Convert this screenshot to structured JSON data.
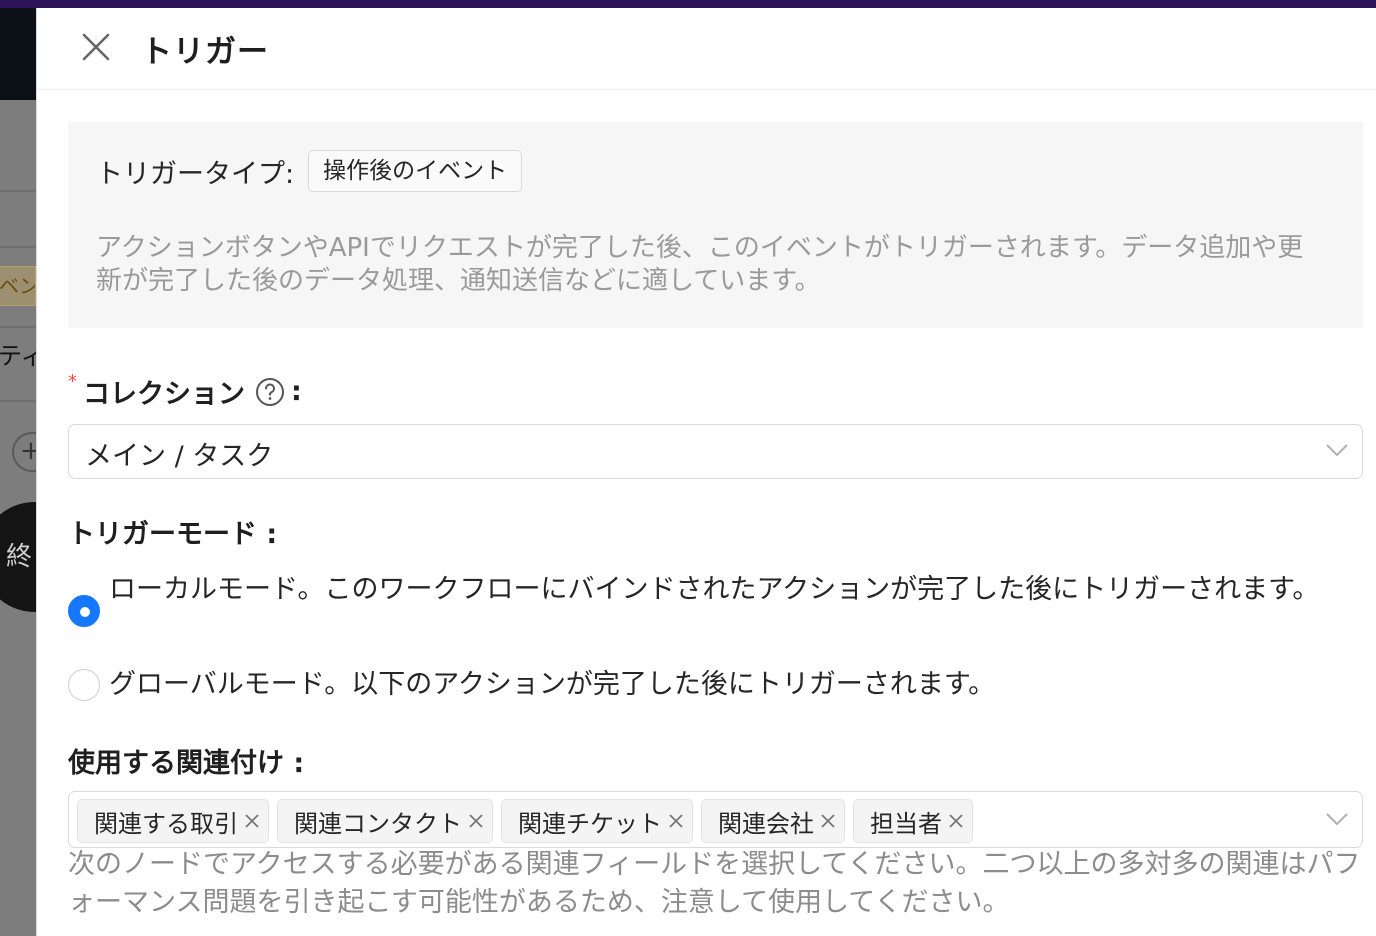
{
  "background": {
    "badge_text": "ベン",
    "partial_text": "ティ",
    "plus_glyph": "+",
    "end_button_text": "終"
  },
  "drawer": {
    "title": "トリガー"
  },
  "trigger_type": {
    "label": "トリガータイプ:",
    "value": "操作後のイベント",
    "description": "アクションボタンやAPIでリクエストが完了した後、このイベントがトリガーされます。データ追加や更新が完了した後のデータ処理、通知送信などに適しています。"
  },
  "collection": {
    "required_mark": "*",
    "label": "コレクション",
    "colon": ":",
    "value": "メイン / タスク"
  },
  "trigger_mode": {
    "label": "トリガーモード :",
    "options": [
      {
        "label": "ローカルモード。このワークフローにバインドされたアクションが完了した後にトリガーされます。",
        "checked": true
      },
      {
        "label": "グローバルモード。以下のアクションが完了した後にトリガーされます。",
        "checked": false
      }
    ]
  },
  "associations": {
    "label": "使用する関連付け :",
    "tags": [
      "関連する取引",
      "関連コンタクト",
      "関連チケット",
      "関連会社",
      "担当者"
    ],
    "help": "次のノードでアクセスする必要がある関連フィールドを選択してください。二つ以上の多対多の関連はパフォーマンス問題を引き起こす可能性があるため、注意して使用してください。"
  },
  "colors": {
    "accent": "#1677ff",
    "required": "#ff4d4f",
    "top_bar": "#2d1458"
  }
}
